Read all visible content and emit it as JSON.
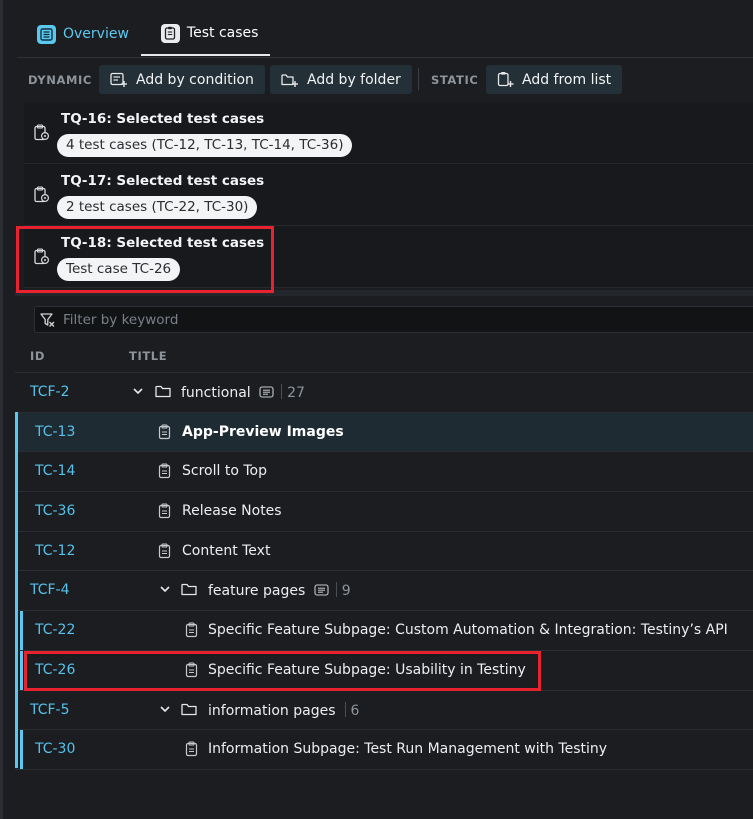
{
  "tabs": {
    "overview": "Overview",
    "test_cases": "Test cases"
  },
  "toolbar": {
    "dynamic_label": "DYNAMIC",
    "add_by_condition": "Add by condition",
    "add_by_folder": "Add by folder",
    "static_label": "STATIC",
    "add_from_list": "Add from list"
  },
  "queries": [
    {
      "title": "TQ-16: Selected test cases",
      "pill": "4 test cases (TC-12, TC-13, TC-14, TC-36)"
    },
    {
      "title": "TQ-17: Selected test cases",
      "pill": "2 test cases (TC-22, TC-30)"
    },
    {
      "title": "TQ-18: Selected test cases",
      "pill": "Test case TC-26"
    }
  ],
  "filter": {
    "placeholder": "Filter by keyword"
  },
  "table": {
    "col_id": "ID",
    "col_title": "TITLE",
    "rows": [
      {
        "id": "TCF-2",
        "title": "functional",
        "count": "27"
      },
      {
        "id": "TC-13",
        "title": "App-Preview Images"
      },
      {
        "id": "TC-14",
        "title": "Scroll to Top"
      },
      {
        "id": "TC-36",
        "title": "Release Notes"
      },
      {
        "id": "TC-12",
        "title": "Content Text"
      },
      {
        "id": "TCF-4",
        "title": "feature pages",
        "count": "9"
      },
      {
        "id": "TC-22",
        "title": "Specific Feature Subpage: Custom Automation & Integration: Testiny’s API"
      },
      {
        "id": "TC-26",
        "title": "Specific Feature Subpage: Usability in Testiny"
      },
      {
        "id": "TCF-5",
        "title": "information pages",
        "count": "6"
      },
      {
        "id": "TC-30",
        "title": "Information Subpage: Test Run Management with Testiny"
      }
    ]
  },
  "colors": {
    "accent": "#5cc8f0",
    "highlight": "#e8232f",
    "background": "#1b1d21"
  }
}
